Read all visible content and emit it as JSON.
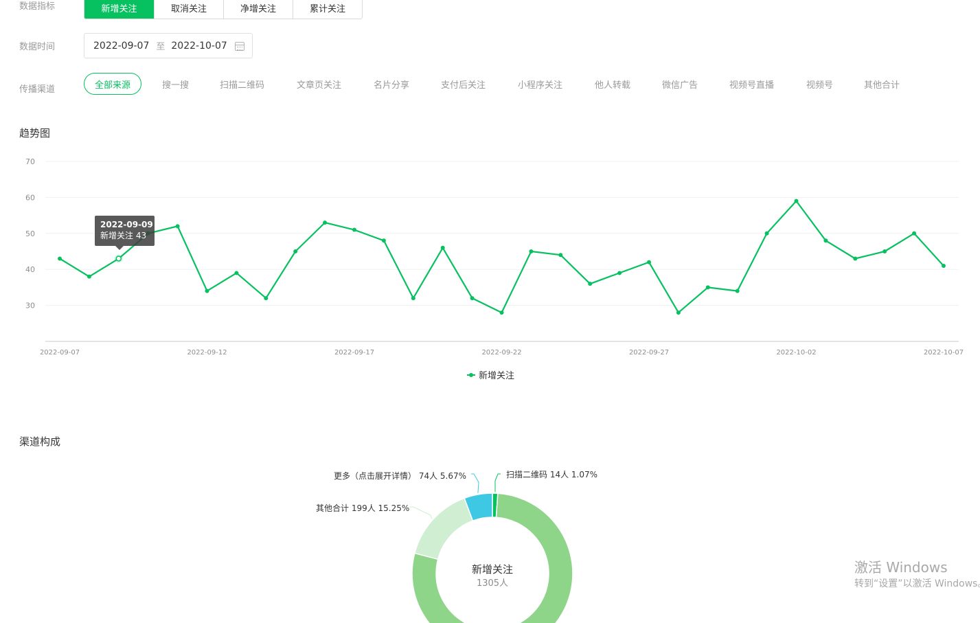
{
  "filters": {
    "metric_label": "数据指标",
    "metric_tabs": [
      {
        "label": "新增关注",
        "active": true
      },
      {
        "label": "取消关注",
        "active": false
      },
      {
        "label": "净增关注",
        "active": false
      },
      {
        "label": "累计关注",
        "active": false
      }
    ],
    "time_label": "数据时间",
    "date_start": "2022-09-07",
    "date_sep": "至",
    "date_end": "2022-10-07",
    "channel_label": "传播渠道",
    "channels": [
      "全部来源",
      "搜一搜",
      "扫描二维码",
      "文章页关注",
      "名片分享",
      "支付后关注",
      "小程序关注",
      "他人转载",
      "微信广告",
      "视频号直播",
      "视频号",
      "其他合计"
    ],
    "active_channel_index": 0
  },
  "trend": {
    "section_title": "趋势图",
    "tooltip": {
      "date": "2022-09-09",
      "text": "新增关注 43"
    },
    "legend_label": "新增关注"
  },
  "composition": {
    "section_title": "渠道构成",
    "center_title": "新增关注",
    "center_sub": "1305人"
  },
  "chart_data": [
    {
      "type": "line",
      "x": [
        "2022-09-07",
        "2022-09-08",
        "2022-09-09",
        "2022-09-10",
        "2022-09-11",
        "2022-09-12",
        "2022-09-13",
        "2022-09-14",
        "2022-09-15",
        "2022-09-16",
        "2022-09-17",
        "2022-09-18",
        "2022-09-19",
        "2022-09-20",
        "2022-09-21",
        "2022-09-22",
        "2022-09-23",
        "2022-09-24",
        "2022-09-25",
        "2022-09-26",
        "2022-09-27",
        "2022-09-28",
        "2022-09-29",
        "2022-09-30",
        "2022-10-01",
        "2022-10-02",
        "2022-10-03",
        "2022-10-04",
        "2022-10-05",
        "2022-10-06",
        "2022-10-07"
      ],
      "x_ticks": [
        "2022-09-07",
        "2022-09-12",
        "2022-09-17",
        "2022-09-22",
        "2022-09-27",
        "2022-10-02",
        "2022-10-07"
      ],
      "series": [
        {
          "name": "新增关注",
          "values": [
            43,
            38,
            43,
            50,
            52,
            34,
            39,
            32,
            45,
            53,
            51,
            48,
            32,
            46,
            32,
            28,
            45,
            44,
            36,
            39,
            42,
            28,
            35,
            34,
            50,
            59,
            48,
            43,
            45,
            50,
            41
          ]
        }
      ],
      "y_ticks": [
        30,
        40,
        50,
        60,
        70
      ],
      "ylim": [
        20,
        70
      ],
      "grid": true,
      "legend": "bottom-center",
      "color": "#07c160"
    },
    {
      "type": "pie",
      "donut": true,
      "slices": [
        {
          "label": "扫描二维码 14人 1.07%",
          "value": 14,
          "percent": 1.07,
          "color": "#07c160"
        },
        {
          "label": "",
          "value": 1018,
          "percent": 78.01,
          "color": "#8ed58a"
        },
        {
          "label": "其他合计 199人 15.25%",
          "value": 199,
          "percent": 15.25,
          "color": "#cfeed2"
        },
        {
          "label": "更多（点击展开详情） 74人 5.67%",
          "value": 74,
          "percent": 5.67,
          "color": "#3fc8e4"
        }
      ]
    }
  ],
  "watermark": {
    "line1": "激活 Windows",
    "line2": "转到“设置”以激活 Windows。"
  }
}
